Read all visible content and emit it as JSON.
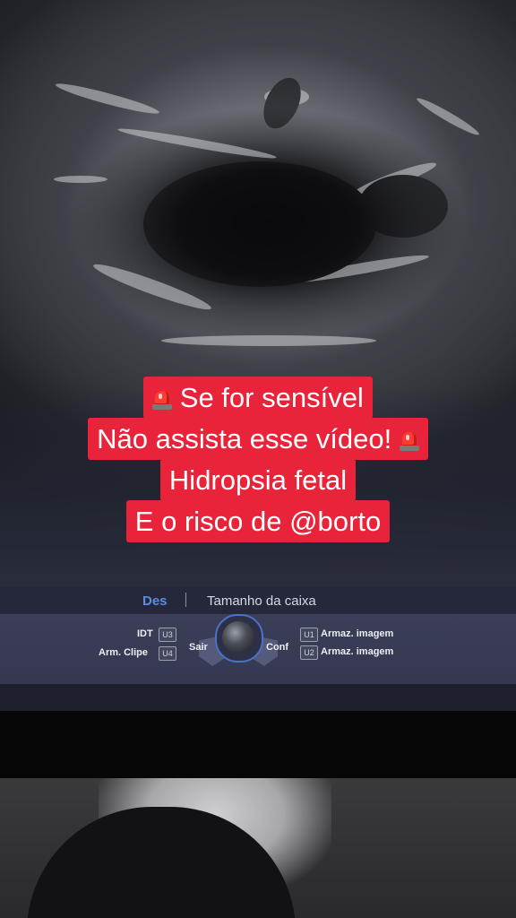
{
  "caption": {
    "line1": "Se for sensível",
    "line2": "Não assista esse vídeo!",
    "line3": "Hidropsia fetal",
    "line4": "E o risco de @borto",
    "icon": "police-siren-icon",
    "background_color": "#e8233a",
    "text_color": "#ffffff"
  },
  "ultrasound_ui": {
    "tabs": {
      "active": "Des",
      "other": "Tamanho da caixa"
    },
    "left_controls": [
      {
        "label": "IDT",
        "key": "U3"
      },
      {
        "label": "Arm. Clipe",
        "key": "U4"
      }
    ],
    "trackball": {
      "left_label": "Sair",
      "right_label": "Conf",
      "icon": "trackball-icon"
    },
    "right_controls": [
      {
        "key": "U1",
        "label": "Armaz. imagem"
      },
      {
        "key": "U2",
        "label": "Armaz. imagem"
      }
    ],
    "accent_color": "#4a72c8"
  }
}
